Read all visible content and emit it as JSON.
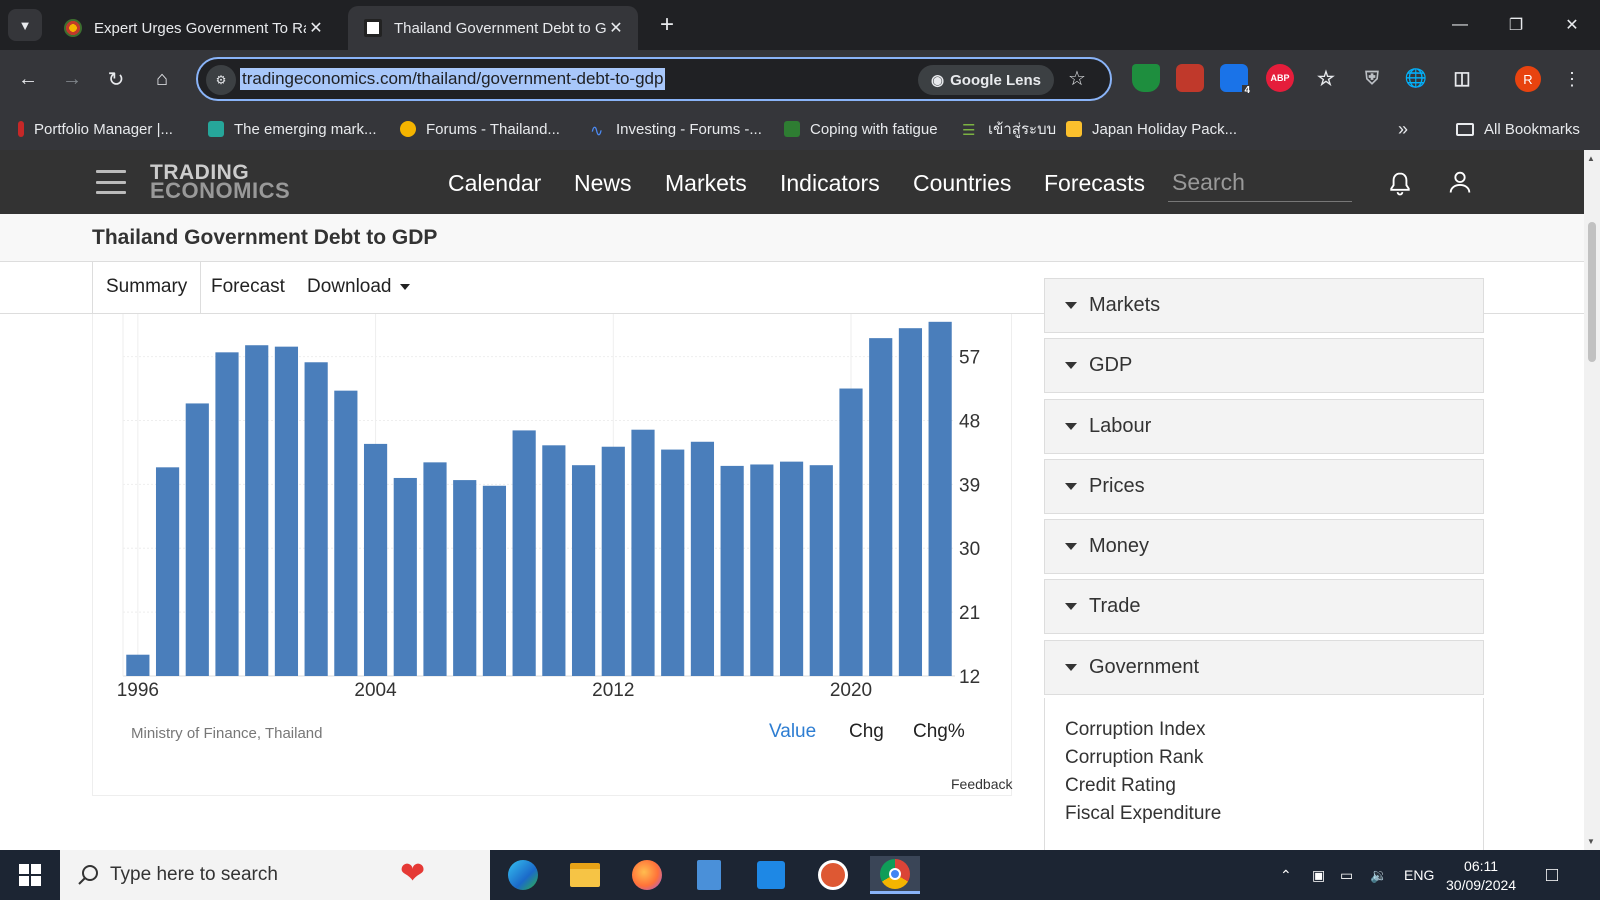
{
  "browser": {
    "tabs": [
      {
        "title": "Expert Urges Government To Ra",
        "active": false
      },
      {
        "title": "Thailand Government Debt to G",
        "active": true
      }
    ],
    "url": "tradingeconomics.com/thailand/government-debt-to-gdp",
    "lens_label": "Google Lens",
    "extension_badge": "4",
    "abp_label": "ABP",
    "profile_initial": "R",
    "bookmarks": [
      "Portfolio Manager |...",
      "The emerging mark...",
      "Forums - Thailand...",
      "Investing - Forums -...",
      "Coping with fatigue",
      "เข้าสู่ระบบ",
      "Japan Holiday Pack..."
    ],
    "more_bookmarks": "»",
    "all_bookmarks": "All Bookmarks"
  },
  "site": {
    "logo_line1": "TRADING",
    "logo_line2": "ECONOMICS",
    "menu": [
      "Calendar",
      "News",
      "Markets",
      "Indicators",
      "Countries",
      "Forecasts"
    ],
    "search_placeholder": "Search",
    "page_title": "Thailand Government Debt to GDP",
    "page_tabs": [
      "Summary",
      "Forecast",
      "Download"
    ],
    "source": "Ministry of Finance, Thailand",
    "toggles": [
      "Value",
      "Chg",
      "Chg%"
    ],
    "feedback": "Feedback"
  },
  "sidebar": {
    "sections": [
      "Markets",
      "GDP",
      "Labour",
      "Prices",
      "Money",
      "Trade",
      "Government"
    ],
    "government_links": [
      "Corruption Index",
      "Corruption Rank",
      "Credit Rating",
      "Fiscal Expenditure"
    ]
  },
  "chart_data": {
    "type": "bar",
    "categories": [
      "1996",
      "1997",
      "1998",
      "1999",
      "2000",
      "2001",
      "2002",
      "2003",
      "2004",
      "2005",
      "2006",
      "2007",
      "2008",
      "2009",
      "2010",
      "2011",
      "2012",
      "2013",
      "2014",
      "2015",
      "2016",
      "2017",
      "2018",
      "2019",
      "2020",
      "2021",
      "2022",
      "2023"
    ],
    "values": [
      15,
      41.4,
      50.4,
      57.6,
      58.6,
      58.4,
      56.2,
      52.2,
      44.7,
      39.9,
      42.1,
      39.6,
      38.8,
      46.6,
      44.5,
      41.7,
      44.3,
      46.7,
      43.9,
      45.0,
      41.6,
      41.8,
      42.2,
      41.7,
      52.5,
      59.6,
      61.0,
      61.9
    ],
    "x_tick_labels": [
      "1996",
      "2004",
      "2012",
      "2020"
    ],
    "y_tick_labels": [
      "57",
      "48",
      "39",
      "30",
      "21",
      "12"
    ],
    "ylim": [
      12,
      63
    ],
    "y_axis_side": "right",
    "bar_color": "#4a7ebb",
    "grid": true
  },
  "taskbar": {
    "search_placeholder": "Type here to search",
    "language": "ENG",
    "time": "06:11",
    "date": "30/09/2024"
  }
}
